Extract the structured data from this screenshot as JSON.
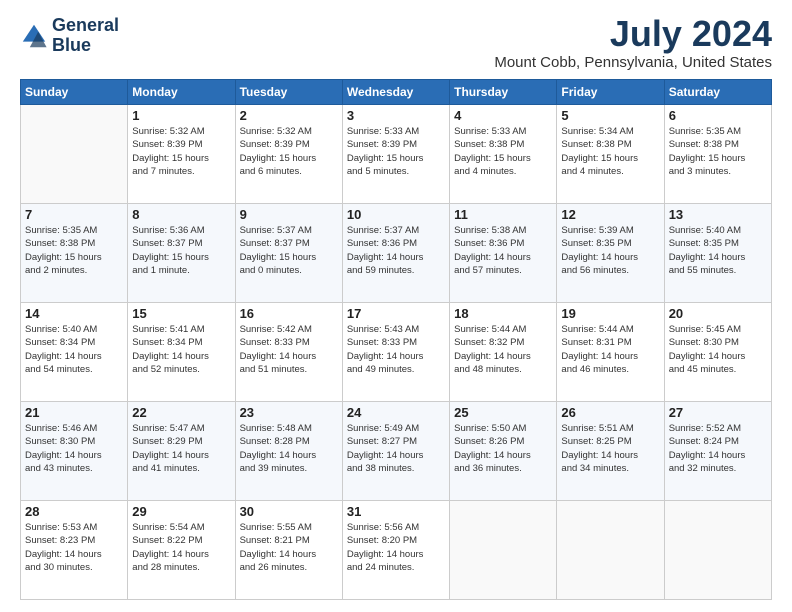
{
  "logo": {
    "line1": "General",
    "line2": "Blue"
  },
  "title": "July 2024",
  "location": "Mount Cobb, Pennsylvania, United States",
  "days_header": [
    "Sunday",
    "Monday",
    "Tuesday",
    "Wednesday",
    "Thursday",
    "Friday",
    "Saturday"
  ],
  "weeks": [
    [
      {
        "day": "",
        "info": ""
      },
      {
        "day": "1",
        "info": "Sunrise: 5:32 AM\nSunset: 8:39 PM\nDaylight: 15 hours\nand 7 minutes."
      },
      {
        "day": "2",
        "info": "Sunrise: 5:32 AM\nSunset: 8:39 PM\nDaylight: 15 hours\nand 6 minutes."
      },
      {
        "day": "3",
        "info": "Sunrise: 5:33 AM\nSunset: 8:39 PM\nDaylight: 15 hours\nand 5 minutes."
      },
      {
        "day": "4",
        "info": "Sunrise: 5:33 AM\nSunset: 8:38 PM\nDaylight: 15 hours\nand 4 minutes."
      },
      {
        "day": "5",
        "info": "Sunrise: 5:34 AM\nSunset: 8:38 PM\nDaylight: 15 hours\nand 4 minutes."
      },
      {
        "day": "6",
        "info": "Sunrise: 5:35 AM\nSunset: 8:38 PM\nDaylight: 15 hours\nand 3 minutes."
      }
    ],
    [
      {
        "day": "7",
        "info": "Sunrise: 5:35 AM\nSunset: 8:38 PM\nDaylight: 15 hours\nand 2 minutes."
      },
      {
        "day": "8",
        "info": "Sunrise: 5:36 AM\nSunset: 8:37 PM\nDaylight: 15 hours\nand 1 minute."
      },
      {
        "day": "9",
        "info": "Sunrise: 5:37 AM\nSunset: 8:37 PM\nDaylight: 15 hours\nand 0 minutes."
      },
      {
        "day": "10",
        "info": "Sunrise: 5:37 AM\nSunset: 8:36 PM\nDaylight: 14 hours\nand 59 minutes."
      },
      {
        "day": "11",
        "info": "Sunrise: 5:38 AM\nSunset: 8:36 PM\nDaylight: 14 hours\nand 57 minutes."
      },
      {
        "day": "12",
        "info": "Sunrise: 5:39 AM\nSunset: 8:35 PM\nDaylight: 14 hours\nand 56 minutes."
      },
      {
        "day": "13",
        "info": "Sunrise: 5:40 AM\nSunset: 8:35 PM\nDaylight: 14 hours\nand 55 minutes."
      }
    ],
    [
      {
        "day": "14",
        "info": "Sunrise: 5:40 AM\nSunset: 8:34 PM\nDaylight: 14 hours\nand 54 minutes."
      },
      {
        "day": "15",
        "info": "Sunrise: 5:41 AM\nSunset: 8:34 PM\nDaylight: 14 hours\nand 52 minutes."
      },
      {
        "day": "16",
        "info": "Sunrise: 5:42 AM\nSunset: 8:33 PM\nDaylight: 14 hours\nand 51 minutes."
      },
      {
        "day": "17",
        "info": "Sunrise: 5:43 AM\nSunset: 8:33 PM\nDaylight: 14 hours\nand 49 minutes."
      },
      {
        "day": "18",
        "info": "Sunrise: 5:44 AM\nSunset: 8:32 PM\nDaylight: 14 hours\nand 48 minutes."
      },
      {
        "day": "19",
        "info": "Sunrise: 5:44 AM\nSunset: 8:31 PM\nDaylight: 14 hours\nand 46 minutes."
      },
      {
        "day": "20",
        "info": "Sunrise: 5:45 AM\nSunset: 8:30 PM\nDaylight: 14 hours\nand 45 minutes."
      }
    ],
    [
      {
        "day": "21",
        "info": "Sunrise: 5:46 AM\nSunset: 8:30 PM\nDaylight: 14 hours\nand 43 minutes."
      },
      {
        "day": "22",
        "info": "Sunrise: 5:47 AM\nSunset: 8:29 PM\nDaylight: 14 hours\nand 41 minutes."
      },
      {
        "day": "23",
        "info": "Sunrise: 5:48 AM\nSunset: 8:28 PM\nDaylight: 14 hours\nand 39 minutes."
      },
      {
        "day": "24",
        "info": "Sunrise: 5:49 AM\nSunset: 8:27 PM\nDaylight: 14 hours\nand 38 minutes."
      },
      {
        "day": "25",
        "info": "Sunrise: 5:50 AM\nSunset: 8:26 PM\nDaylight: 14 hours\nand 36 minutes."
      },
      {
        "day": "26",
        "info": "Sunrise: 5:51 AM\nSunset: 8:25 PM\nDaylight: 14 hours\nand 34 minutes."
      },
      {
        "day": "27",
        "info": "Sunrise: 5:52 AM\nSunset: 8:24 PM\nDaylight: 14 hours\nand 32 minutes."
      }
    ],
    [
      {
        "day": "28",
        "info": "Sunrise: 5:53 AM\nSunset: 8:23 PM\nDaylight: 14 hours\nand 30 minutes."
      },
      {
        "day": "29",
        "info": "Sunrise: 5:54 AM\nSunset: 8:22 PM\nDaylight: 14 hours\nand 28 minutes."
      },
      {
        "day": "30",
        "info": "Sunrise: 5:55 AM\nSunset: 8:21 PM\nDaylight: 14 hours\nand 26 minutes."
      },
      {
        "day": "31",
        "info": "Sunrise: 5:56 AM\nSunset: 8:20 PM\nDaylight: 14 hours\nand 24 minutes."
      },
      {
        "day": "",
        "info": ""
      },
      {
        "day": "",
        "info": ""
      },
      {
        "day": "",
        "info": ""
      }
    ]
  ]
}
